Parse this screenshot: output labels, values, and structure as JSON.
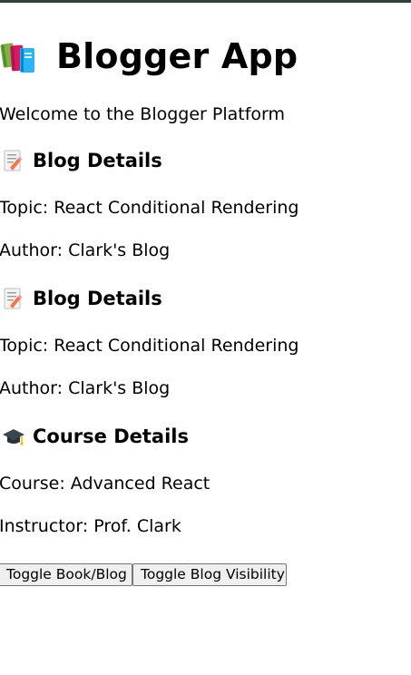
{
  "header": {
    "title": "Blogger App",
    "icon": "books-icon"
  },
  "welcome_text": "Welcome to the Blogger Platform",
  "sections": [
    {
      "icon": "memo-icon",
      "title": "Blog Details",
      "line1": "Topic: React Conditional Rendering",
      "line2": "Author: Clark's Blog"
    },
    {
      "icon": "memo-icon",
      "title": "Blog Details",
      "line1": "Topic: React Conditional Rendering",
      "line2": "Author: Clark's Blog"
    },
    {
      "icon": "graduation-cap-icon",
      "title": "Course Details",
      "line1": "Course: Advanced React",
      "line2": "Instructor: Prof. Clark"
    }
  ],
  "buttons": {
    "toggle_book_blog": "Toggle Book/Blog",
    "toggle_blog_visibility": "Toggle Blog Visibility"
  },
  "colors": {
    "top_bar": "#2f3f3f",
    "button_bg": "#efefef",
    "button_border": "#767676"
  }
}
